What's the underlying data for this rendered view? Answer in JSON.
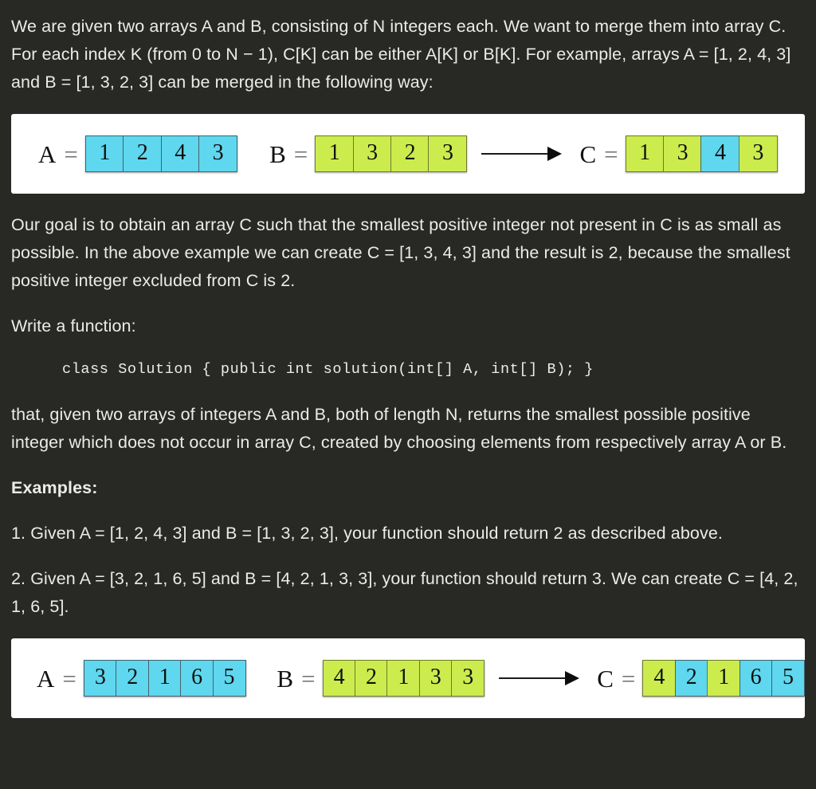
{
  "document": {
    "paragraphs": {
      "intro": "We are given two arrays A and B, consisting of N integers each. We want to merge them into array C. For each index K (from 0 to N − 1), C[K] can be either A[K] or B[K]. For example, arrays A = [1, 2, 4, 3] and B = [1, 3, 2, 3] can be merged in the following way:",
      "goal": "Our goal is to obtain an array C such that the smallest positive integer not present in C is as small as possible. In the above example we can create C = [1, 3, 4, 3] and the result is 2, because the smallest positive integer excluded from C is 2.",
      "write_function": "Write a function:",
      "code": "class Solution { public int solution(int[] A, int[] B); }",
      "that_given": "that, given two arrays of integers A and B, both of length N, returns the smallest possible positive integer which does not occur in array C, created by choosing elements from respectively array A or B.",
      "examples_heading": "Examples:",
      "example_1": "1. Given A = [1, 2, 4, 3] and B = [1, 3, 2, 3], your function should return 2 as described above.",
      "example_2": "2. Given A = [3, 2, 1, 6, 5] and B = [4, 2, 1, 3, 3], your function should return 3. We can create C = [4, 2, 1, 6, 5]."
    }
  },
  "colors": {
    "background": "#282924",
    "text": "#ebebe9",
    "figure_background": "#ffffff",
    "cell_blue": "#5fd7ee",
    "cell_green": "#ccec4e",
    "cell_blue_border": "#41636c",
    "cell_green_border": "#6e7a2c",
    "arrow": "#0d0d0d"
  },
  "figures": [
    {
      "id": "figure-example-1",
      "arrays": [
        {
          "name": "A",
          "equals": "=",
          "cells": [
            {
              "value": "1",
              "color": "blue"
            },
            {
              "value": "2",
              "color": "blue"
            },
            {
              "value": "4",
              "color": "blue"
            },
            {
              "value": "3",
              "color": "blue"
            }
          ]
        },
        {
          "name": "B",
          "equals": "=",
          "cells": [
            {
              "value": "1",
              "color": "green"
            },
            {
              "value": "3",
              "color": "green"
            },
            {
              "value": "2",
              "color": "green"
            },
            {
              "value": "3",
              "color": "green"
            }
          ]
        },
        {
          "name": "C",
          "equals": "=",
          "cells": [
            {
              "value": "1",
              "color": "green"
            },
            {
              "value": "3",
              "color": "green"
            },
            {
              "value": "4",
              "color": "blue"
            },
            {
              "value": "3",
              "color": "green"
            }
          ]
        }
      ]
    },
    {
      "id": "figure-example-2",
      "arrays": [
        {
          "name": "A",
          "equals": "=",
          "cells": [
            {
              "value": "3",
              "color": "blue"
            },
            {
              "value": "2",
              "color": "blue"
            },
            {
              "value": "1",
              "color": "blue"
            },
            {
              "value": "6",
              "color": "blue"
            },
            {
              "value": "5",
              "color": "blue"
            }
          ]
        },
        {
          "name": "B",
          "equals": "=",
          "cells": [
            {
              "value": "4",
              "color": "green"
            },
            {
              "value": "2",
              "color": "green"
            },
            {
              "value": "1",
              "color": "green"
            },
            {
              "value": "3",
              "color": "green"
            },
            {
              "value": "3",
              "color": "green"
            }
          ]
        },
        {
          "name": "C",
          "equals": "=",
          "cells": [
            {
              "value": "4",
              "color": "green"
            },
            {
              "value": "2",
              "color": "blue"
            },
            {
              "value": "1",
              "color": "green"
            },
            {
              "value": "6",
              "color": "blue"
            },
            {
              "value": "5",
              "color": "blue"
            }
          ]
        }
      ]
    }
  ]
}
